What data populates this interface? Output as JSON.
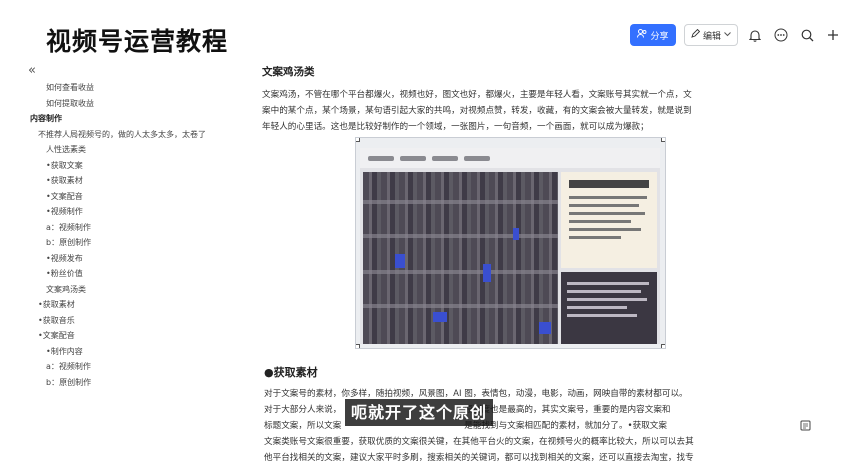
{
  "header": {
    "big_title": "视频号运营教程"
  },
  "toolbar": {
    "share_label": "分享",
    "edit_label": "编辑",
    "share_icon": "users-icon",
    "edit_icon": "pencil-icon",
    "bell_icon": "bell-icon",
    "more_icon": "more-icon",
    "search_icon": "search-icon",
    "add_icon": "plus-icon",
    "accent_color": "#3370ff"
  },
  "sidebar": {
    "collapse_glyph": "«",
    "items": [
      {
        "label": "如何查看收益",
        "indent": 46,
        "bold": false
      },
      {
        "label": "如何提取收益",
        "indent": 46,
        "bold": false
      },
      {
        "label": "内容制作",
        "indent": 30,
        "bold": true
      },
      {
        "label": "不推荐人局视频号的，做的人太多太多，太卷了",
        "indent": 38,
        "bold": false
      },
      {
        "label": "人性选素类",
        "indent": 46,
        "bold": false
      },
      {
        "label": "•获取文案",
        "indent": 46,
        "bold": false
      },
      {
        "label": "•获取素材",
        "indent": 46,
        "bold": false
      },
      {
        "label": "•文案配音",
        "indent": 46,
        "bold": false
      },
      {
        "label": "•视频制作",
        "indent": 46,
        "bold": false
      },
      {
        "label": "a：视频制作",
        "indent": 46,
        "bold": false
      },
      {
        "label": "b：原创制作",
        "indent": 46,
        "bold": false
      },
      {
        "label": "•视频发布",
        "indent": 46,
        "bold": false
      },
      {
        "label": "•粉丝价值",
        "indent": 46,
        "bold": false
      },
      {
        "label": "文案鸡汤类",
        "indent": 46,
        "bold": false
      },
      {
        "label": "•获取素材",
        "indent": 38,
        "bold": false
      },
      {
        "label": "•获取音乐",
        "indent": 38,
        "bold": false
      },
      {
        "label": "•文案配音",
        "indent": 38,
        "bold": false
      },
      {
        "label": "•制作内容",
        "indent": 46,
        "bold": false
      },
      {
        "label": "a：视频制作",
        "indent": 46,
        "bold": false
      },
      {
        "label": "b：原创制作",
        "indent": 46,
        "bold": false
      }
    ]
  },
  "main": {
    "section1_title": "文案鸡汤类",
    "section1_lines": [
      "文案鸡汤，不管在哪个平台都爆火，视频也好，图文也好，都爆火，主要是年轻人看，文案账号其实就一个点，文",
      "案中的某个点，某个场景，某句语引起大家的共鸣，对视频点赞，转发，收藏，有的文案会被大量转发，就是说到",
      "年轻人的心里话。这也是比较好制作的一个领域，一张图片，一句音频，一个画面，就可以成为爆款；"
    ],
    "section2_title": "●获取素材",
    "section2_lines": [
      "对于文案号的素材，你多样，随拍视频，风景图，AI 图，表情包，动漫，电影，动画，网映自带的素材都可以。",
      "对于大部分人来说，                                             原创度也是最高的，其实文案号，重要的是内容文案和",
      "标题文案，所以文案                                             是能找到与文案相匹配的素材，就加分了。•获取文案",
      "文案类账号文案很重要，获取优质的文案很关键，在其他平台火的文案，在视频号火的概率比较大，所以可以去其",
      "他平台找相关的文案，建议大家平时多刷，搜索相关的关键词，都可以找到相关的文案，还可以直接去淘宝，找专"
    ]
  },
  "overlay": {
    "subtitle": "呃就开了这个原创"
  }
}
